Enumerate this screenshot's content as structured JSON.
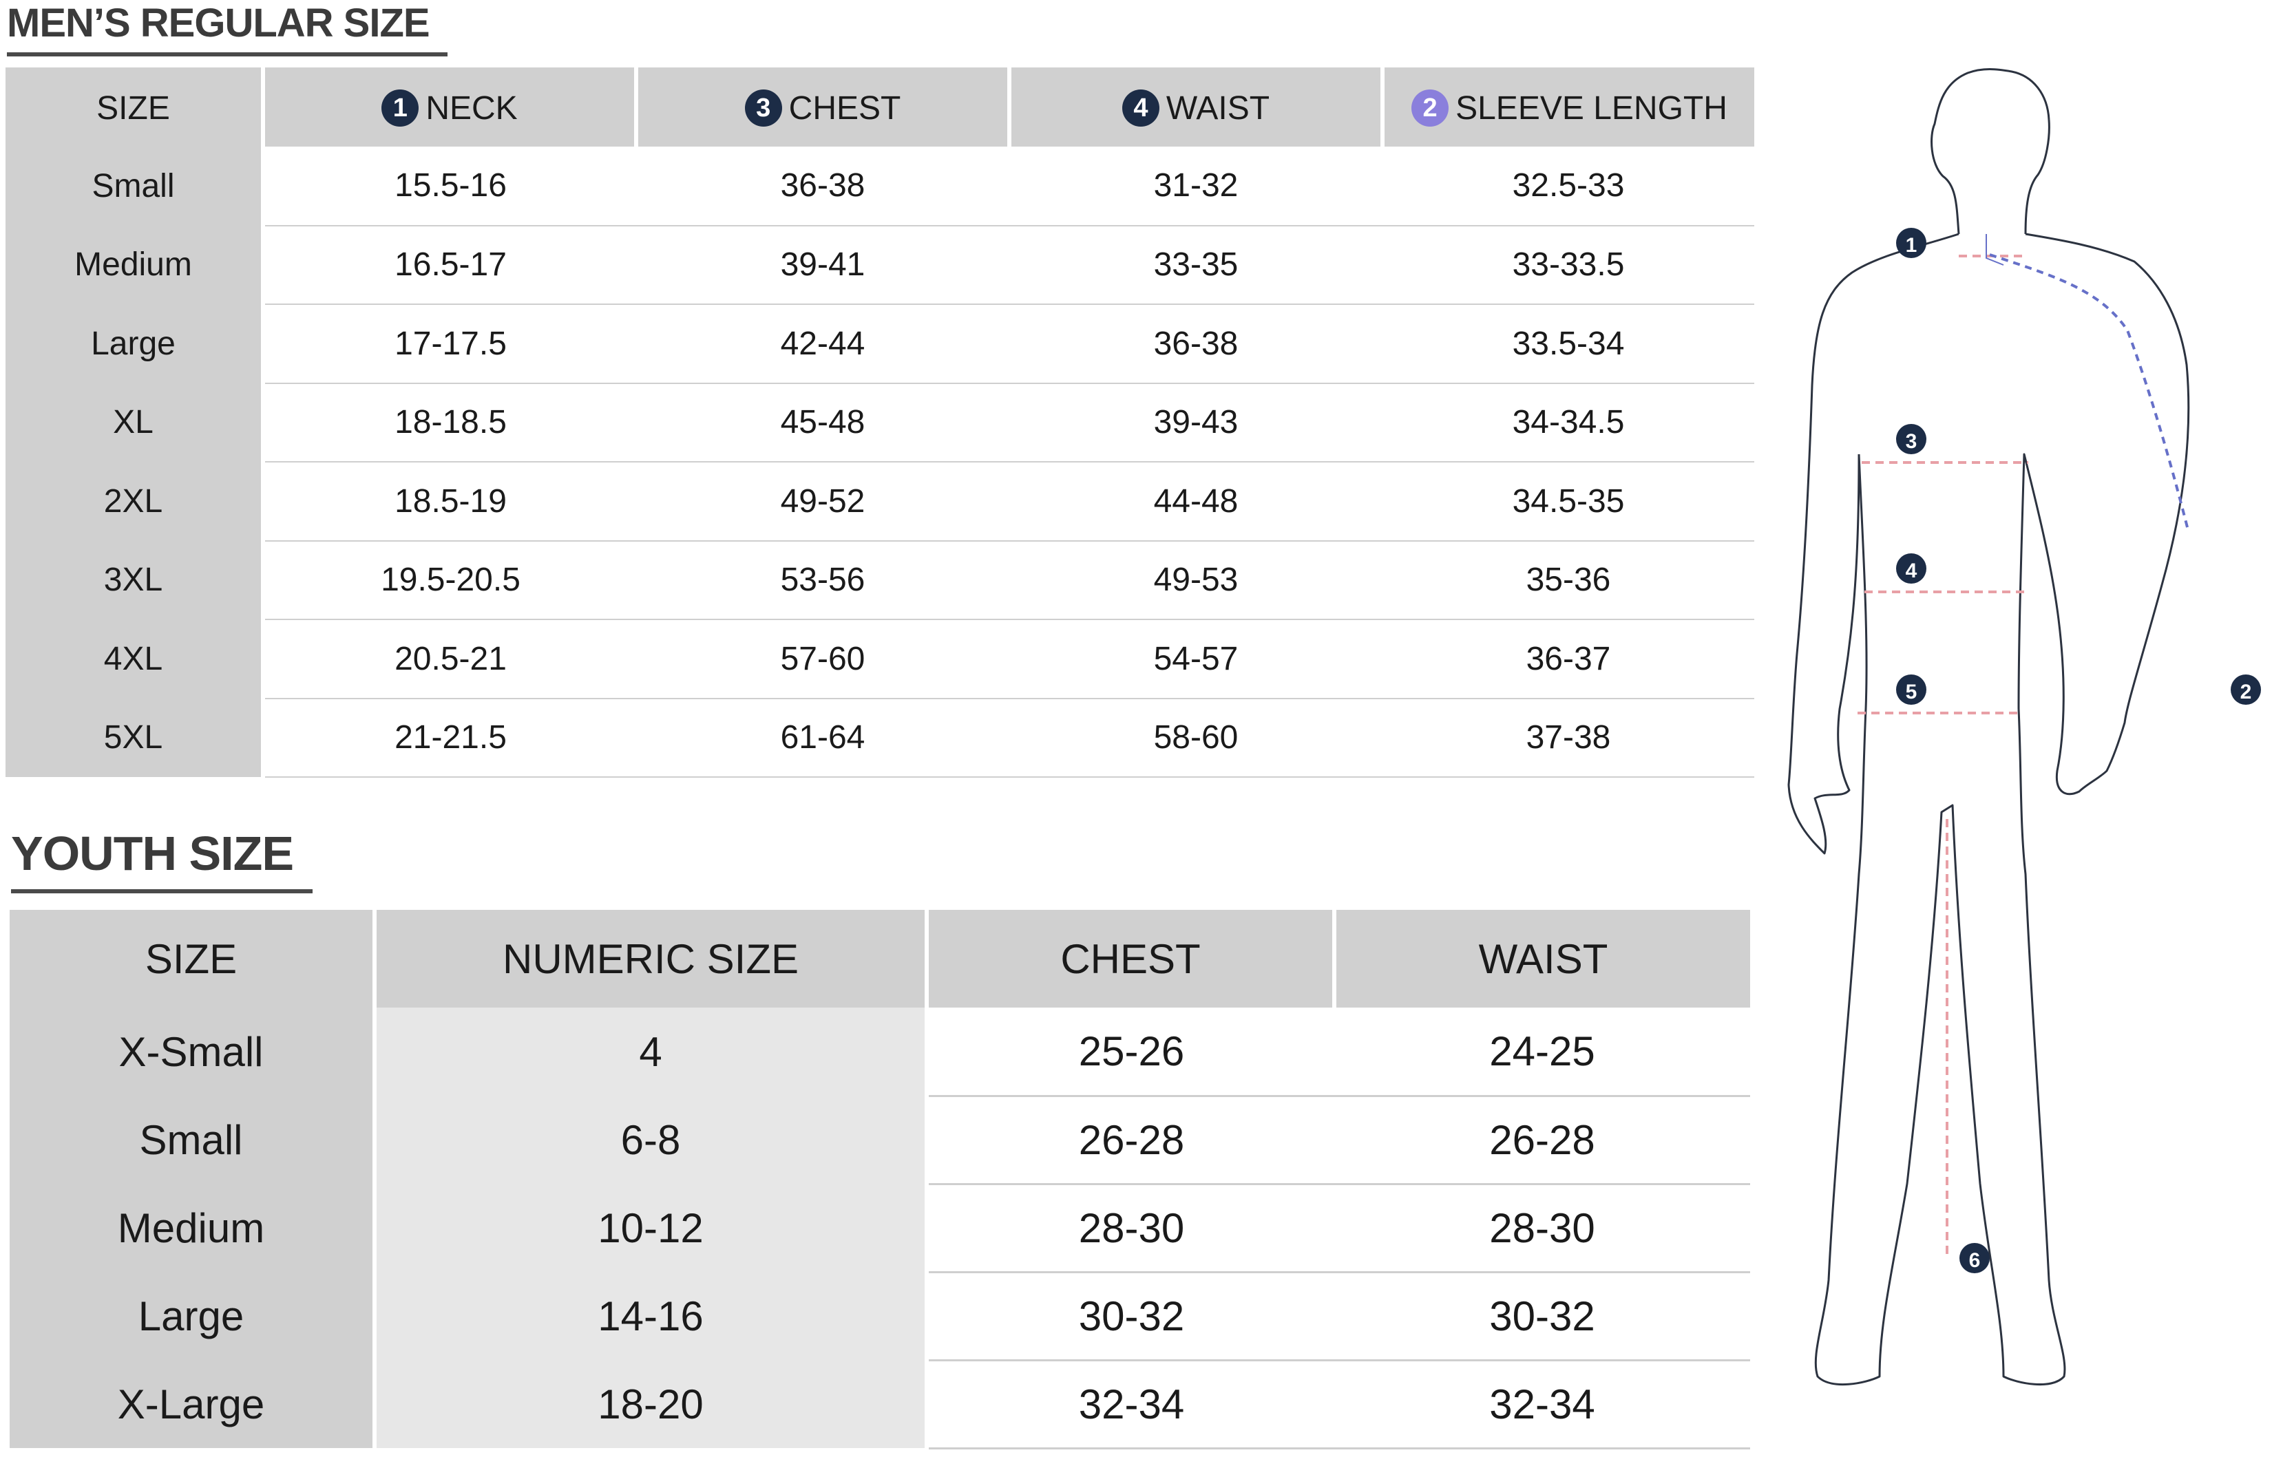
{
  "men": {
    "title": "MEN’S REGULAR SIZE",
    "headers": {
      "size": "SIZE",
      "neck": {
        "badge": "1",
        "label": "NECK"
      },
      "chest": {
        "badge": "3",
        "label": "CHEST"
      },
      "waist": {
        "badge": "4",
        "label": "WAIST"
      },
      "sleeve": {
        "badge": "2",
        "label": "SLEEVE LENGTH"
      }
    },
    "rows": [
      {
        "size": "Small",
        "neck": "15.5-16",
        "chest": "36-38",
        "waist": "31-32",
        "sleeve": "32.5-33"
      },
      {
        "size": "Medium",
        "neck": "16.5-17",
        "chest": "39-41",
        "waist": "33-35",
        "sleeve": "33-33.5"
      },
      {
        "size": "Large",
        "neck": "17-17.5",
        "chest": "42-44",
        "waist": "36-38",
        "sleeve": "33.5-34"
      },
      {
        "size": "XL",
        "neck": "18-18.5",
        "chest": "45-48",
        "waist": "39-43",
        "sleeve": "34-34.5"
      },
      {
        "size": "2XL",
        "neck": "18.5-19",
        "chest": "49-52",
        "waist": "44-48",
        "sleeve": "34.5-35"
      },
      {
        "size": "3XL",
        "neck": "19.5-20.5",
        "chest": "53-56",
        "waist": "49-53",
        "sleeve": "35-36"
      },
      {
        "size": "4XL",
        "neck": "20.5-21",
        "chest": "57-60",
        "waist": "54-57",
        "sleeve": "36-37"
      },
      {
        "size": "5XL",
        "neck": "21-21.5",
        "chest": "61-64",
        "waist": "58-60",
        "sleeve": "37-38"
      }
    ]
  },
  "youth": {
    "title": "YOUTH SIZE",
    "headers": {
      "size": "SIZE",
      "numeric": "NUMERIC SIZE",
      "chest": "CHEST",
      "waist": "WAIST"
    },
    "rows": [
      {
        "size": "X-Small",
        "numeric": "4",
        "chest": "25-26",
        "waist": "24-25"
      },
      {
        "size": "Small",
        "numeric": "6-8",
        "chest": "26-28",
        "waist": "26-28"
      },
      {
        "size": "Medium",
        "numeric": "10-12",
        "chest": "28-30",
        "waist": "28-30"
      },
      {
        "size": "Large",
        "numeric": "14-16",
        "chest": "30-32",
        "waist": "30-32"
      },
      {
        "size": "X-Large",
        "numeric": "18-20",
        "chest": "32-34",
        "waist": "32-34"
      }
    ]
  },
  "figure": {
    "markers": [
      "1",
      "2",
      "3",
      "4",
      "5",
      "6"
    ]
  },
  "colors": {
    "header_gray": "#d0d0d0",
    "badge_navy": "#1c2c46",
    "badge_purple": "#8a7fdc",
    "measure_red": "#e8a0a6",
    "measure_blue": "#6670c8"
  }
}
